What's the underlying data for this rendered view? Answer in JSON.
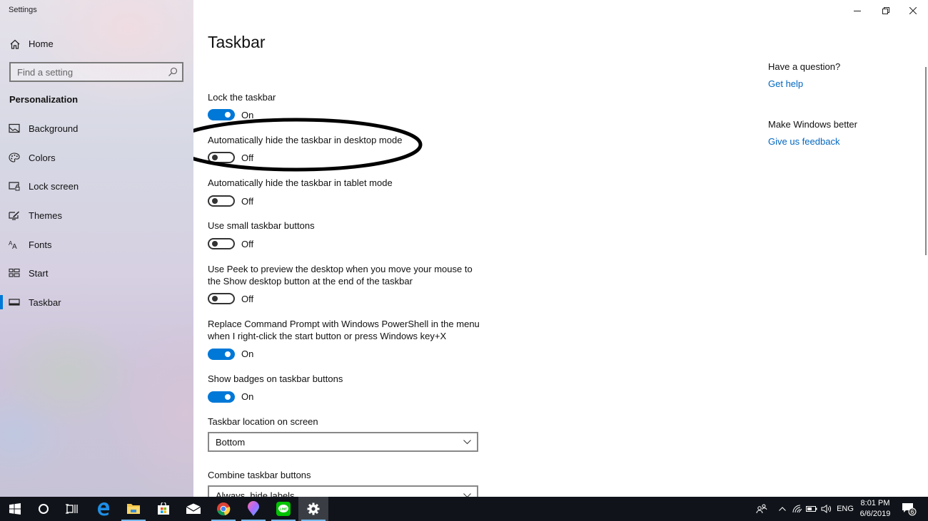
{
  "app": {
    "title": "Settings"
  },
  "sidebar": {
    "home_label": "Home",
    "search_placeholder": "Find a setting",
    "section_title": "Personalization",
    "items": [
      {
        "label": "Background",
        "icon": "image-icon"
      },
      {
        "label": "Colors",
        "icon": "palette-icon"
      },
      {
        "label": "Lock screen",
        "icon": "lock-screen-icon"
      },
      {
        "label": "Themes",
        "icon": "themes-icon"
      },
      {
        "label": "Fonts",
        "icon": "fonts-icon"
      },
      {
        "label": "Start",
        "icon": "start-icon"
      },
      {
        "label": "Taskbar",
        "icon": "taskbar-icon",
        "active": true
      }
    ]
  },
  "main": {
    "title": "Taskbar",
    "settings": [
      {
        "label": "Lock the taskbar",
        "state": "On"
      },
      {
        "label": "Automatically hide the taskbar in desktop mode",
        "state": "Off"
      },
      {
        "label": "Automatically hide the taskbar in tablet mode",
        "state": "Off"
      },
      {
        "label": "Use small taskbar buttons",
        "state": "Off"
      },
      {
        "label": "Use Peek to preview the desktop when you move your mouse to the Show desktop button at the end of the taskbar",
        "state": "Off"
      },
      {
        "label": "Replace Command Prompt with Windows PowerShell in the menu when I right-click the start button or press Windows key+X",
        "state": "On"
      },
      {
        "label": "Show badges on taskbar buttons",
        "state": "On"
      }
    ],
    "dropdowns": [
      {
        "label": "Taskbar location on screen",
        "value": "Bottom"
      },
      {
        "label": "Combine taskbar buttons",
        "value": "Always, hide labels"
      }
    ]
  },
  "help": {
    "question_title": "Have a question?",
    "get_help": "Get help",
    "better_title": "Make Windows better",
    "feedback": "Give us feedback"
  },
  "accent_color": "#0078d7",
  "taskbar": {
    "apps": [
      "start-icon",
      "cortana-icon",
      "task-view-icon",
      "edge-icon",
      "file-explorer-icon",
      "store-icon",
      "mail-icon",
      "chrome-icon",
      "paint3d-icon",
      "line-icon",
      "settings-icon"
    ],
    "tray": {
      "language": "ENG",
      "time": "8:01 PM",
      "date": "6/6/2019",
      "notifications": "6"
    }
  }
}
